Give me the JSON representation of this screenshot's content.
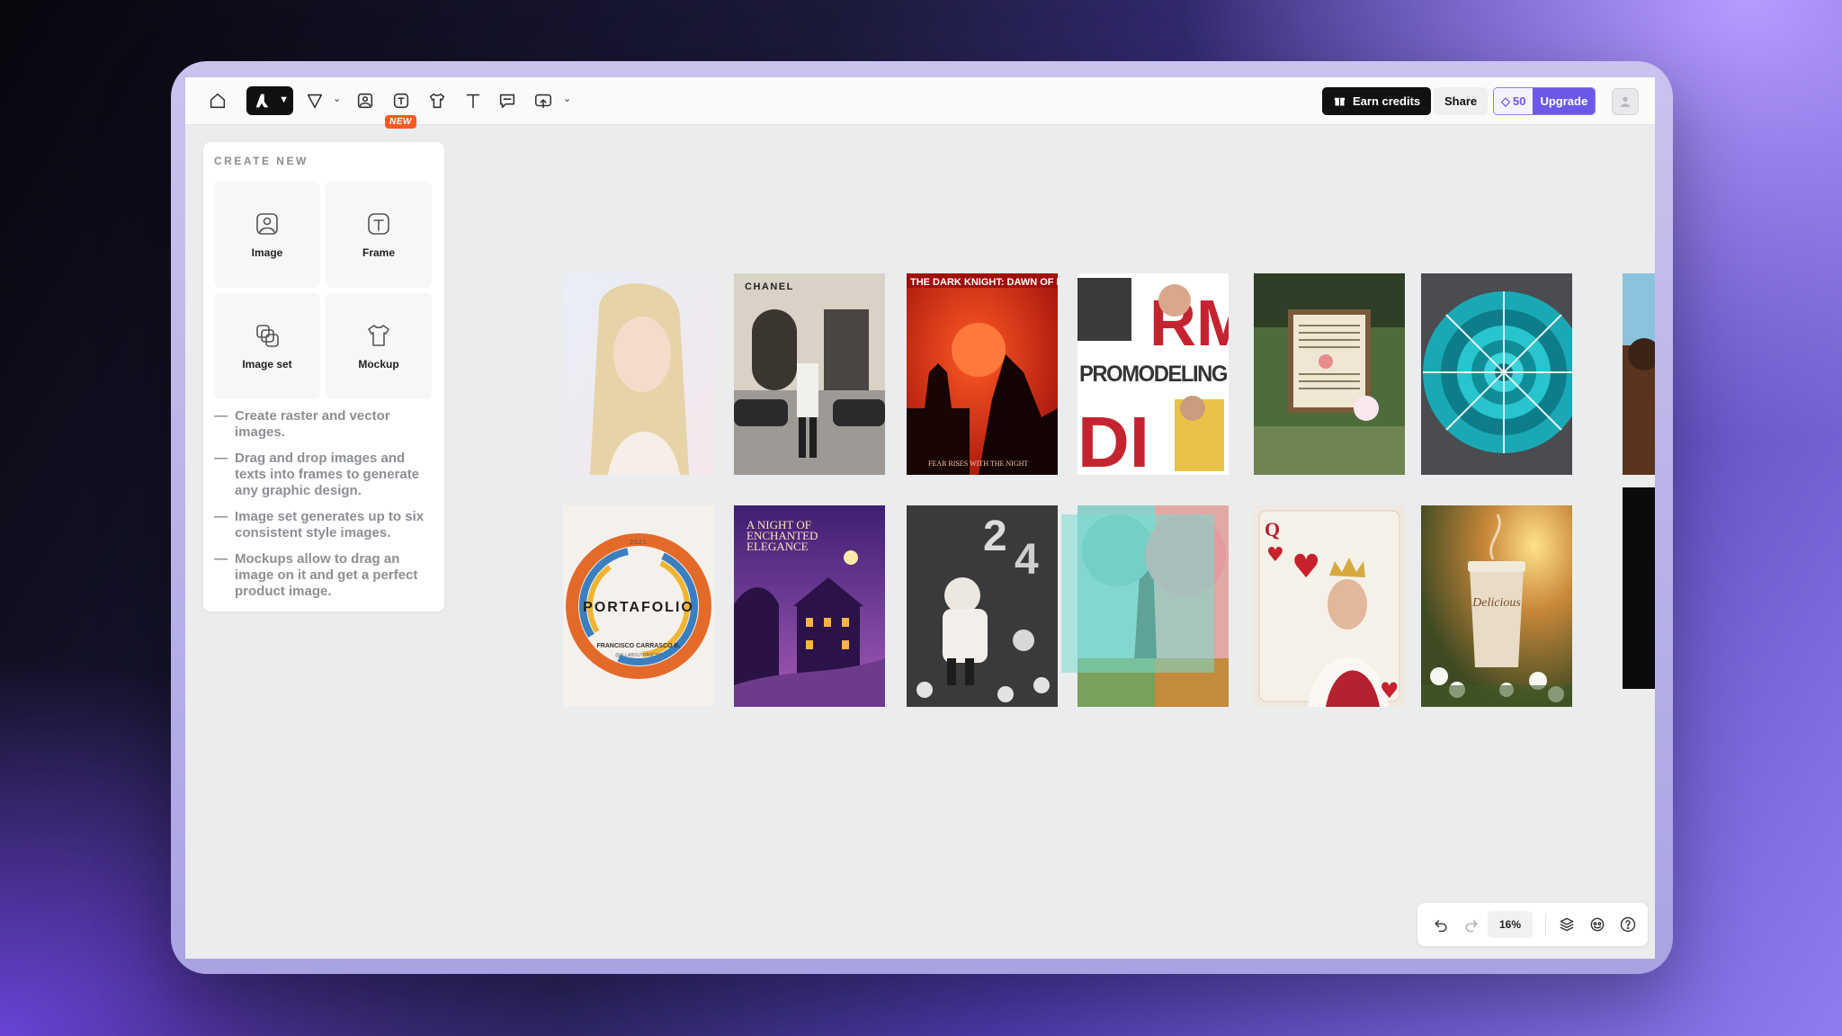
{
  "toolbar": {
    "new_badge": "NEW",
    "earn_credits": "Earn credits",
    "share": "Share",
    "credits": "50",
    "upgrade": "Upgrade"
  },
  "create_panel": {
    "title": "CREATE NEW",
    "tiles": [
      {
        "label": "Image",
        "icon": "image-icon"
      },
      {
        "label": "Frame",
        "icon": "frame-icon"
      },
      {
        "label": "Image set",
        "icon": "image-set-icon"
      },
      {
        "label": "Mockup",
        "icon": "tshirt-icon"
      }
    ],
    "tips": [
      "Create raster and vector images.",
      "Drag and drop images and texts into frames to generate any graphic design.",
      "Image set generates up to six consistent style images.",
      "Mockups allow to drag an image on it and get a perfect product image."
    ]
  },
  "canvas": {
    "cards": [
      {
        "name": "card-blonde-portrait"
      },
      {
        "name": "card-chanel-street",
        "text": "CHANEL"
      },
      {
        "name": "card-dark-knight",
        "text": "THE DARK KNIGHT: DAWN OF FE",
        "subtext": "FEAR RISES WITH THE NIGHT"
      },
      {
        "name": "card-promodeling",
        "text": "PROMODELING"
      },
      {
        "name": "card-garden-sign"
      },
      {
        "name": "card-nautilus"
      },
      {
        "name": "card-portafolio",
        "text": "PORTAFOLIO",
        "year": "2021",
        "subtext": "FRANCISCO CARRASCO B.",
        "handle": "@ALLABOUTPANCHO"
      },
      {
        "name": "card-enchanted-elegance",
        "text": "A NIGHT OF ENCHANTED ELEGANCE"
      },
      {
        "name": "card-birthday-24"
      },
      {
        "name": "card-seasons-tree"
      },
      {
        "name": "card-queen-of-hearts"
      },
      {
        "name": "card-coffee-cup",
        "text": "Delicious"
      }
    ]
  },
  "bottom_bar": {
    "zoom": "16%"
  },
  "colors": {
    "accent": "#6b58e8",
    "new_badge": "#ff5a1f",
    "dark_button": "#111111"
  }
}
